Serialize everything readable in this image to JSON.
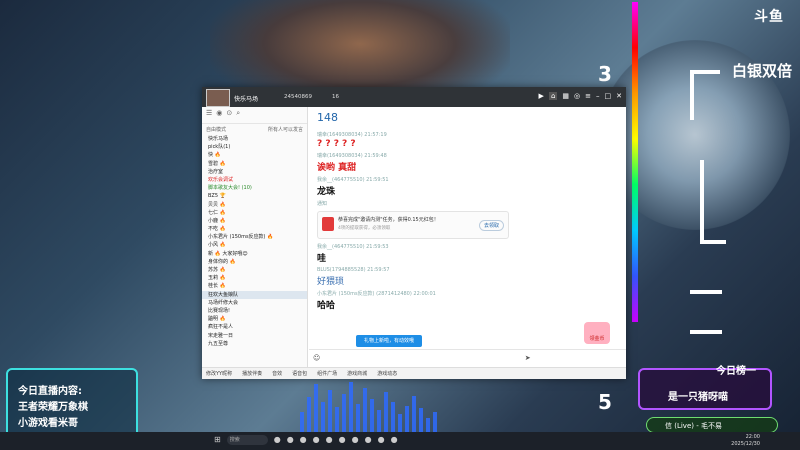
{
  "brand": {
    "logo": "斗鱼"
  },
  "overlay": {
    "num_top": "3",
    "num_bottom": "5",
    "baiyin": "白银双倍",
    "cat_box": {
      "lines": [
        "今日直播内容:",
        "王者荣耀万象棋",
        "小游戏看米哥"
      ]
    },
    "rank": {
      "title": "今日榜一",
      "name": "是一只猪呀喵",
      "clock_big": "22:00"
    },
    "song": "信 (Live) - 毛不易"
  },
  "window": {
    "title_name": "快乐马场",
    "room_id": "24540869",
    "count": "16",
    "sidebar": {
      "mode_label": "自由模式",
      "right_label": "所有人可以发言",
      "items": [
        {
          "label": "快乐马场",
          "style": ""
        },
        {
          "label": "pick队(1)",
          "style": ""
        },
        {
          "label": "快 🔥",
          "style": ""
        },
        {
          "label": "雪碧 🔥",
          "style": ""
        },
        {
          "label": "治疗室",
          "style": ""
        },
        {
          "label": "欢乐会调试",
          "style": "red"
        },
        {
          "label": "脚本歌友大会! (10)",
          "style": "green"
        },
        {
          "label": "BZ5 🏆",
          "style": ""
        },
        {
          "label": "贝贝 🔥",
          "style": ""
        },
        {
          "label": "七仁 🔥",
          "style": ""
        },
        {
          "label": "小鹿 🔥",
          "style": ""
        },
        {
          "label": "不吃 🔥",
          "style": ""
        },
        {
          "label": "小东君片 (150ms反应款) 🔥",
          "style": ""
        },
        {
          "label": "小风 🔥",
          "style": ""
        },
        {
          "label": "新 🔥 大家好哦😊",
          "style": ""
        },
        {
          "label": "身体你的 🔥",
          "style": ""
        },
        {
          "label": "苏苏 🔥",
          "style": ""
        },
        {
          "label": "玉莉 🔥",
          "style": ""
        },
        {
          "label": "桂长 🔥",
          "style": ""
        },
        {
          "label": "狂欢大鱼娘队",
          "style": "sel"
        },
        {
          "label": "马场纤修大会",
          "style": ""
        },
        {
          "label": "比赛现场!",
          "style": ""
        },
        {
          "label": "鼬明 🔥",
          "style": ""
        },
        {
          "label": "疯狂不是人",
          "style": ""
        },
        {
          "label": "宋走雅一日",
          "style": ""
        },
        {
          "label": "九五至尊",
          "style": ""
        }
      ]
    },
    "chat": {
      "header": "148",
      "messages": [
        {
          "meta": "瑞幸(1649308034)  21:57:19",
          "text": "? ? ? ? ?",
          "style": "red"
        },
        {
          "meta": "瑞幸(1649308034)  21:59:48",
          "text": "诶哟 真甜",
          "style": "red"
        },
        {
          "meta": "我余__(464775510)  21:59:51",
          "text": "龙珠",
          "style": "bold"
        }
      ],
      "notice": {
        "header": "通知",
        "title": "恭喜完成\"邀请内测\"任务，获得0.15元红包！",
        "sub": "4项的提取获得，必须领取",
        "button": "去领取"
      },
      "messages2": [
        {
          "meta": "我余__(464775510)  21:59:53",
          "text": "哇",
          "style": "bold"
        },
        {
          "meta": "BLUS(1794885528)  21:59:57",
          "text": "好猥琐",
          "style": "blue"
        },
        {
          "meta": "小东君片 (150ms反应款) (2871412480)  22:00:01",
          "text": "哈哈",
          "style": "bold"
        }
      ],
      "gift_badge": "领金币",
      "tip": "礼物上新啦，有动效哦"
    },
    "bottombar": [
      "修改YY昵称",
      "播放伴奏",
      "音效",
      "语音包",
      "组件广场",
      "游戏商城",
      "游戏动态"
    ]
  },
  "taskbar": {
    "search": "搜索",
    "time": "22:00",
    "date": "2025/12/30"
  }
}
